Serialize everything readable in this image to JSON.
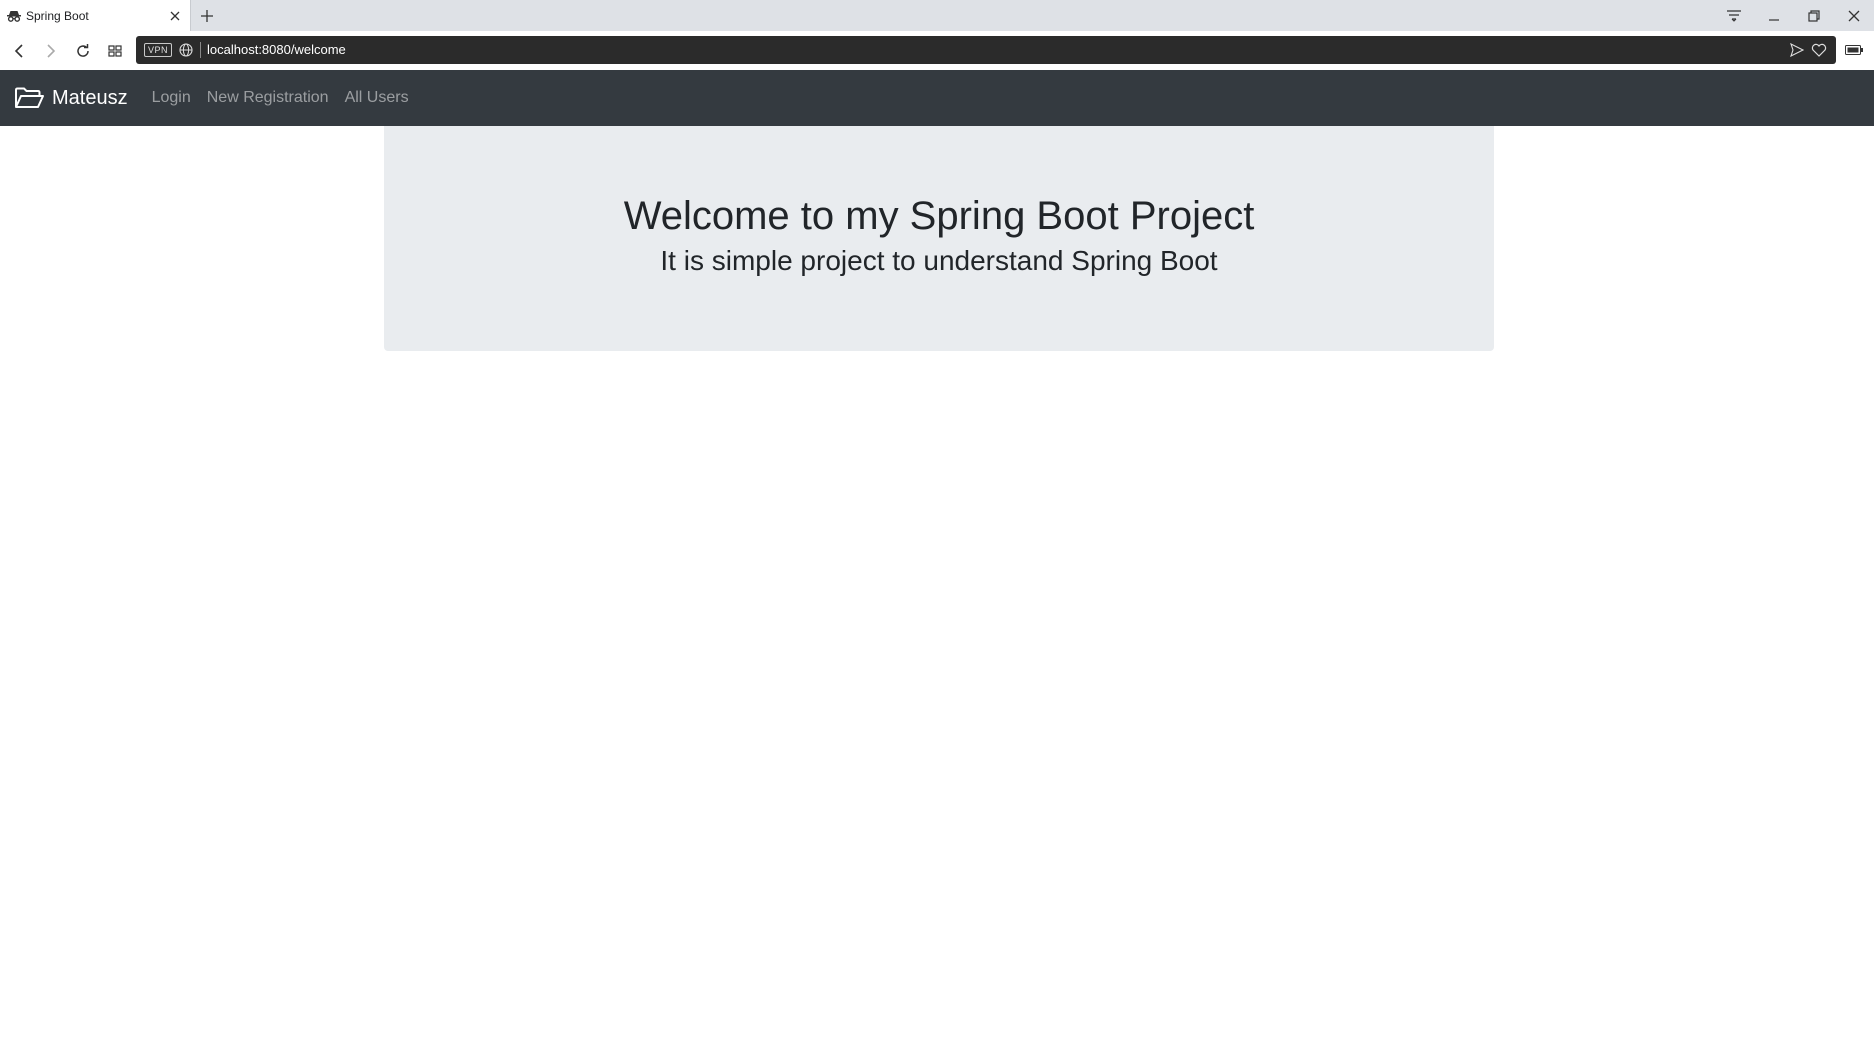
{
  "browser": {
    "tab": {
      "title": "Spring Boot",
      "favicon": "incognito-icon"
    },
    "address_bar": {
      "vpn_label": "VPN",
      "url": "localhost:8080/welcome"
    },
    "icons": {
      "back": "back-arrow-icon",
      "forward": "forward-arrow-icon",
      "reload": "reload-icon",
      "tabs_grid": "grid-icon",
      "send": "send-icon",
      "bookmark": "heart-icon",
      "battery": "battery-icon",
      "menu": "menu-icon",
      "minimize": "minimize-icon",
      "restore": "restore-icon",
      "close": "close-icon"
    }
  },
  "navbar": {
    "brand": "Mateusz",
    "brand_icon": "folder-open-icon",
    "links": [
      {
        "label": "Login"
      },
      {
        "label": "New Registration"
      },
      {
        "label": "All Users"
      }
    ]
  },
  "jumbotron": {
    "heading": "Welcome to my Spring Boot Project",
    "subheading": "It is simple project to understand Spring Boot"
  },
  "colors": {
    "navbar_bg": "#343a40",
    "jumbotron_bg": "#e9ecef",
    "text": "#212529"
  }
}
